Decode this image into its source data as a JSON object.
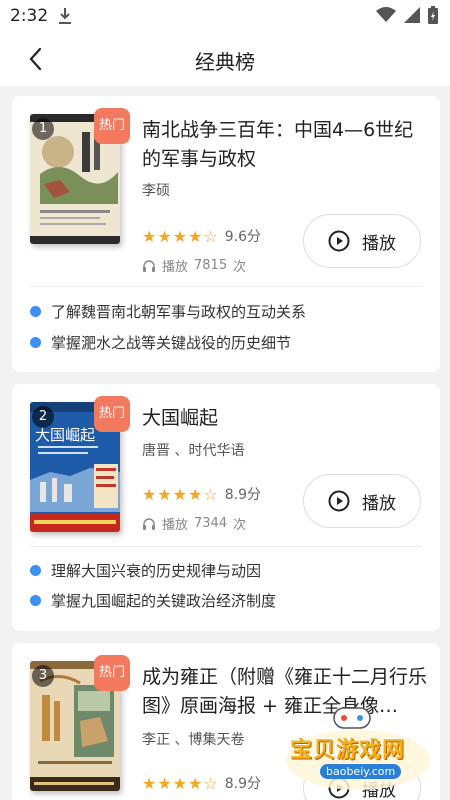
{
  "status_bar": {
    "time": "2:32",
    "icons": [
      "download-icon",
      "wifi-icon",
      "signal-icon",
      "battery-icon"
    ]
  },
  "header": {
    "title": "经典榜",
    "back_icon": "back-arrow-icon"
  },
  "badge_hot": "热门",
  "play_label": "播放",
  "plays_prefix": "播放",
  "plays_suffix": "次",
  "colors": {
    "hot_badge": "#f37a5e",
    "star": "#f5a623",
    "bullet": "#3f8ef4"
  },
  "books": [
    {
      "rank": "1",
      "title": "南北战争三百年：中国4—6世纪的军事与政权",
      "author": "李硕",
      "stars_text": "★★★★☆",
      "rating": 4.5,
      "score": "9.6分",
      "plays": "7815",
      "points": [
        "了解魏晋南北朝军事与政权的互动关系",
        "掌握淝水之战等关键战役的历史细节"
      ]
    },
    {
      "rank": "2",
      "title": "大国崛起",
      "author": "唐晋 、时代华语",
      "stars_text": "★★★★☆",
      "rating": 4.5,
      "score": "8.9分",
      "plays": "7344",
      "points": [
        "理解大国兴衰的历史规律与动因",
        "掌握九国崛起的关键政治经济制度"
      ]
    },
    {
      "rank": "3",
      "title": "成为雍正（附赠《雍正十二月行乐图》原画海报 + 雍正全身像…",
      "author": "李正 、博集天卷",
      "stars_text": "★★★★☆",
      "rating": 4.5,
      "score": "8.9分",
      "plays": "",
      "points": []
    }
  ],
  "cover_texts": {
    "book2_title": "大国崛起"
  },
  "watermark": {
    "text": "宝贝游戏网",
    "url": "baobeiy.com"
  }
}
